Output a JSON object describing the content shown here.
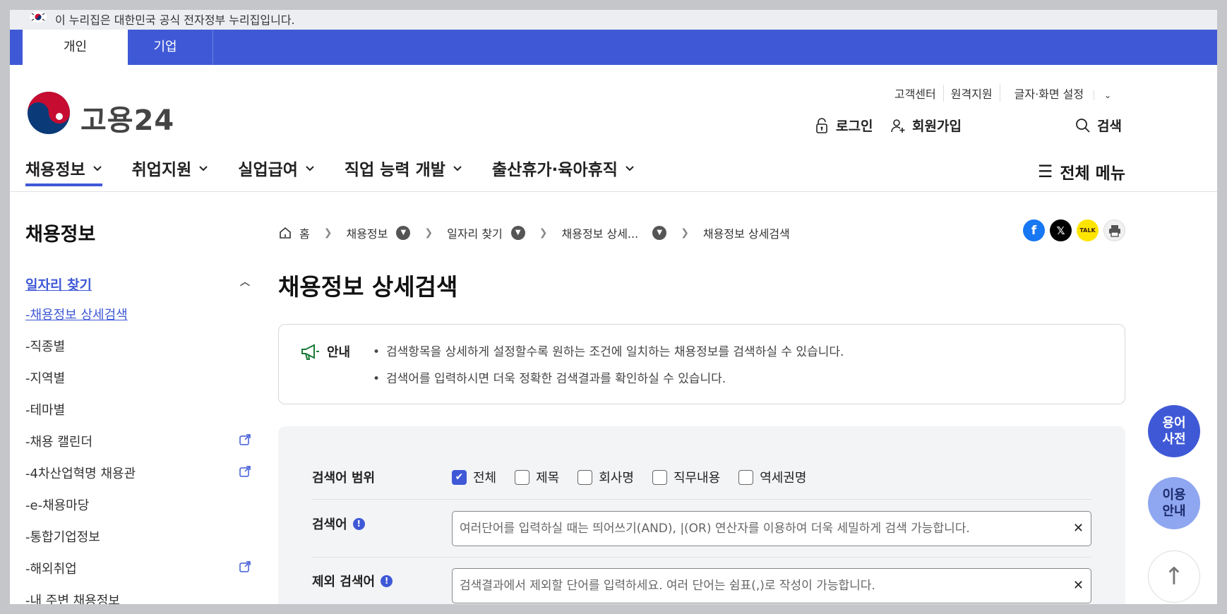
{
  "gov_banner": {
    "text": "이 누리집은 대한민국 공식 전자정부 누리집입니다."
  },
  "audience_tabs": [
    {
      "label": "개인"
    },
    {
      "label": "기업"
    }
  ],
  "brand": {
    "name": "고용24"
  },
  "util_links": {
    "customer_center": "고객센터",
    "remote_support": "원격지원",
    "display_settings": "글자·화면 설정"
  },
  "account": {
    "login": "로그인",
    "signup": "회원가입",
    "search": "검색"
  },
  "gnb": [
    {
      "label": "채용정보"
    },
    {
      "label": "취업지원"
    },
    {
      "label": "실업급여"
    },
    {
      "label": "직업 능력 개발"
    },
    {
      "label": "출산휴가·육아휴직"
    }
  ],
  "all_menu": "전체 메뉴",
  "sidebar": {
    "title": "채용정보",
    "section": "일자리 찾기",
    "items": [
      {
        "label": "-채용정보 상세검색"
      },
      {
        "label": "-직종별"
      },
      {
        "label": "-지역별"
      },
      {
        "label": "-테마별"
      },
      {
        "label": "-채용 캘린더"
      },
      {
        "label": "-4차산업혁명 채용관"
      },
      {
        "label": "-e-채용마당"
      },
      {
        "label": "-통합기업정보"
      },
      {
        "label": "-해외취업"
      },
      {
        "label": "-내 주변 채용정보"
      }
    ]
  },
  "breadcrumb": {
    "home": "홈",
    "c1": "채용정보",
    "c2": "일자리 찾기",
    "c3": "채용정보 상세...",
    "c4": "채용정보 상세검색"
  },
  "page_title": "채용정보 상세검색",
  "notice": {
    "label": "안내",
    "lines": [
      "검색항목을 상세하게 설정할수록 원하는 조건에 일치하는 채용정보를 검색하실 수 있습니다.",
      "검색어를 입력하시면 더욱 정확한 검색결과를 확인하실 수 있습니다."
    ]
  },
  "form": {
    "scope_label": "검색어 범위",
    "scope_options": [
      {
        "label": "전체",
        "checked": true
      },
      {
        "label": "제목",
        "checked": false
      },
      {
        "label": "회사명",
        "checked": false
      },
      {
        "label": "직무내용",
        "checked": false
      },
      {
        "label": "역세권명",
        "checked": false
      }
    ],
    "keyword_label": "검색어",
    "keyword_placeholder": "여러단어를 입력하실 때는 띄어쓰기(AND), |(OR) 연산자를 이용하여 더욱 세밀하게 검색 가능합니다.",
    "exclude_label": "제외 검색어",
    "exclude_placeholder": "검색결과에서 제외할 단어를 입력하세요. 여러 단어는 쉼표(,)로 작성이 가능합니다."
  },
  "floating": {
    "glossary": "용어 사전",
    "guide": "이용 안내",
    "top": "↑"
  },
  "colors": {
    "primary": "#3f59d6",
    "guide_bg": "#8fa6f0"
  }
}
